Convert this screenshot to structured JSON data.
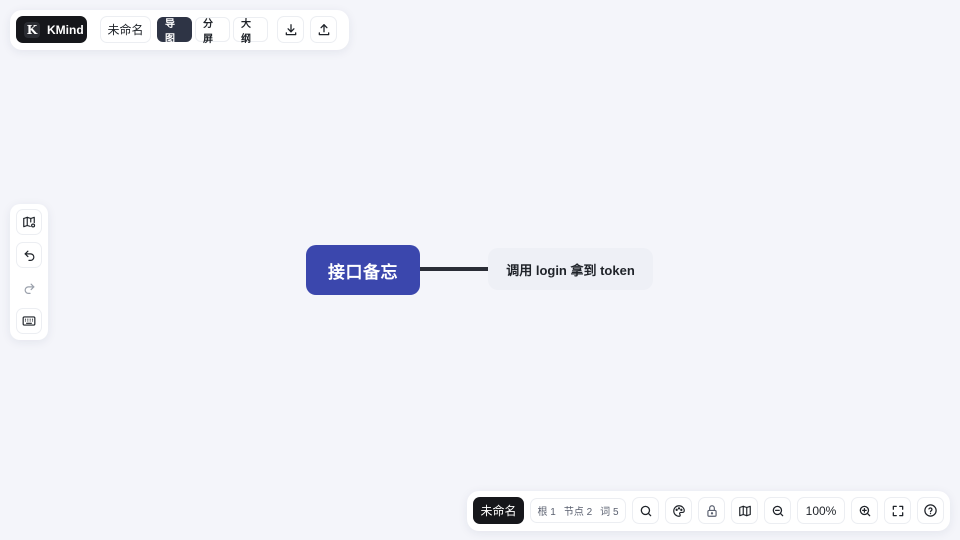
{
  "app": {
    "brand": "KMind",
    "logo_letter": "K"
  },
  "top_toolbar": {
    "doc_title": "未命名",
    "modes": [
      {
        "label": "导图",
        "active": true
      },
      {
        "label": "分屏",
        "active": false
      },
      {
        "label": "大纲",
        "active": false
      }
    ],
    "icons": {
      "download": "download-icon",
      "upload": "upload-icon"
    }
  },
  "left_toolbar": {
    "icons": [
      "map-settings-icon",
      "undo-icon",
      "redo-icon",
      "keyboard-icon"
    ]
  },
  "mindmap": {
    "root": "接口备忘",
    "children": [
      "调用 login 拿到 token"
    ],
    "colors": {
      "root_bg": "#3b47ad",
      "child_bg": "#eef0f6",
      "line": "#2a2d36"
    }
  },
  "bottom_toolbar": {
    "doc_title": "未命名",
    "stats": {
      "root": "根 1",
      "nodes": "节点 2",
      "words": "词 5"
    },
    "zoom": "100%",
    "icons": [
      "search-icon",
      "theme-icon",
      "lock-icon",
      "map-icon",
      "zoom-out-icon",
      "zoom-in-icon",
      "fullscreen-icon",
      "help-icon"
    ]
  }
}
